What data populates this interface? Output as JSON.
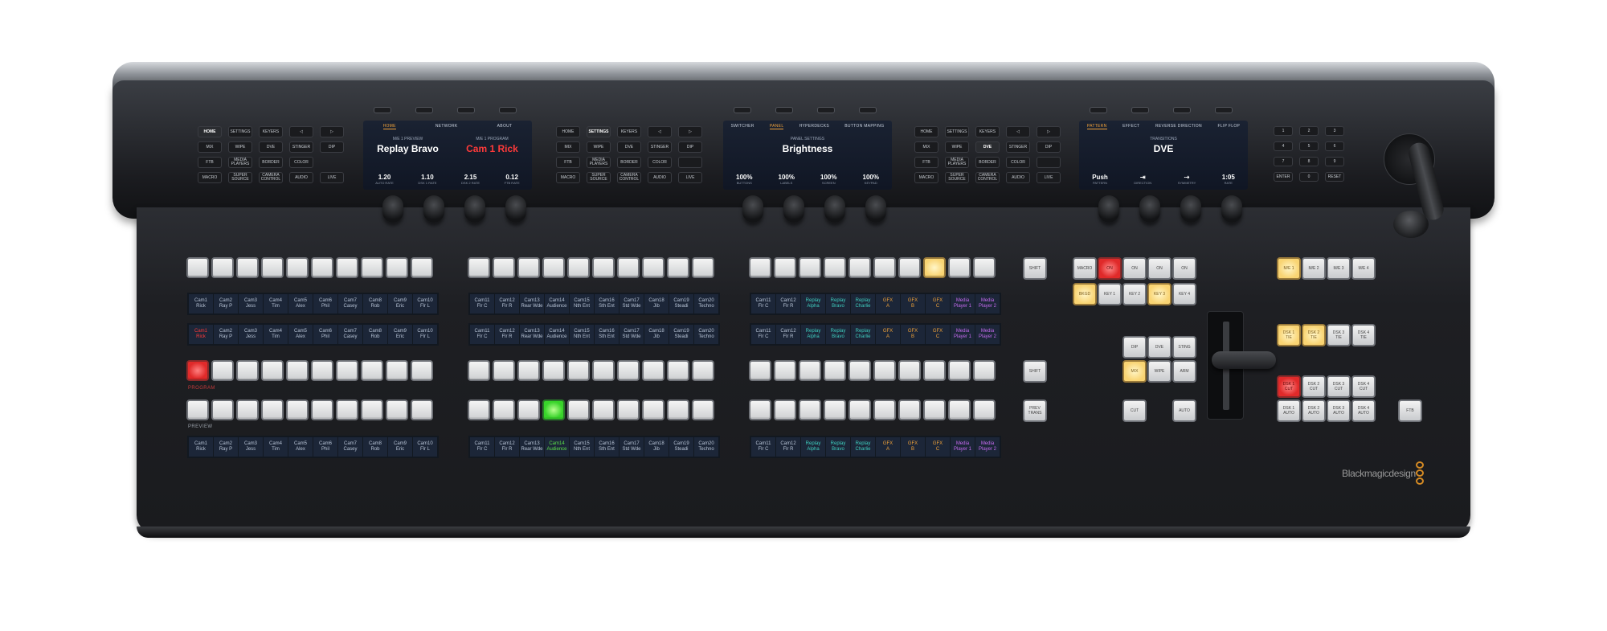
{
  "panel": {
    "brand": "Blackmagic",
    "brand_suffix": "design"
  },
  "control_grids": [
    {
      "rows": [
        [
          {
            "label": "HOME",
            "sel": true
          },
          {
            "label": "SETTINGS"
          },
          {
            "label": "KEYERS"
          },
          {
            "label": "◁"
          },
          {
            "label": "▷"
          }
        ],
        [
          {
            "label": "MIX"
          },
          {
            "label": "WIPE"
          },
          {
            "label": "DVE"
          },
          {
            "label": "STINGER"
          },
          {
            "label": "DIP"
          }
        ],
        [
          {
            "label": "FTB"
          },
          {
            "label": "MEDIA PLAYERS"
          },
          {
            "label": "BORDER"
          },
          {
            "label": "COLOR"
          }
        ],
        [
          {
            "label": "MACRO"
          },
          {
            "label": "SUPER SOURCE"
          },
          {
            "label": "CAMERA CONTROL"
          },
          {
            "label": "AUDIO"
          },
          {
            "label": "LIVE"
          }
        ]
      ]
    },
    {
      "rows": [
        [
          {
            "label": "HOME"
          },
          {
            "label": "SETTINGS",
            "sel": true
          },
          {
            "label": "KEYERS"
          },
          {
            "label": "◁"
          },
          {
            "label": "▷"
          }
        ],
        [
          {
            "label": "MIX"
          },
          {
            "label": "WIPE"
          },
          {
            "label": "DVE"
          },
          {
            "label": "STINGER"
          },
          {
            "label": "DIP"
          }
        ],
        [
          {
            "label": "FTB"
          },
          {
            "label": "MEDIA PLAYERS"
          },
          {
            "label": "BORDER"
          },
          {
            "label": "COLOR"
          },
          {
            "label": ""
          }
        ],
        [
          {
            "label": "MACRO"
          },
          {
            "label": "SUPER SOURCE"
          },
          {
            "label": "CAMERA CONTROL"
          },
          {
            "label": "AUDIO"
          },
          {
            "label": "LIVE"
          }
        ]
      ]
    },
    {
      "rows": [
        [
          {
            "label": "HOME"
          },
          {
            "label": "SETTINGS"
          },
          {
            "label": "KEYERS"
          },
          {
            "label": "◁"
          },
          {
            "label": "▷"
          }
        ],
        [
          {
            "label": "MIX"
          },
          {
            "label": "WIPE"
          },
          {
            "label": "DVE",
            "sel": true
          },
          {
            "label": "STINGER"
          },
          {
            "label": "DIP"
          }
        ],
        [
          {
            "label": "FTB"
          },
          {
            "label": "MEDIA PLAYERS"
          },
          {
            "label": "BORDER"
          },
          {
            "label": "COLOR"
          },
          {
            "label": ""
          }
        ],
        [
          {
            "label": "MACRO"
          },
          {
            "label": "SUPER SOURCE"
          },
          {
            "label": "CAMERA CONTROL"
          },
          {
            "label": "AUDIO"
          },
          {
            "label": "LIVE"
          }
        ]
      ]
    }
  ],
  "lcds": [
    {
      "tabs": [
        {
          "label": "HOME",
          "active": true
        },
        {
          "label": "NETWORK"
        },
        {
          "label": "ABOUT"
        }
      ],
      "left": {
        "sub": "M/E 1 PREVIEW",
        "big": "Replay Bravo"
      },
      "right": {
        "sub": "M/E 1 PROGRAM",
        "big": "Cam 1 Rick"
      },
      "vals": [
        {
          "v": "1.20",
          "l": "AUTO RATE"
        },
        {
          "v": "1.10",
          "l": "DSK 1 RATE"
        },
        {
          "v": "2.15",
          "l": "DSK 2 RATE"
        },
        {
          "v": "0.12",
          "l": "FTB RATE"
        }
      ]
    },
    {
      "tabs": [
        {
          "label": "SWITCHER"
        },
        {
          "label": "PANEL",
          "active": true
        },
        {
          "label": "HYPERDECKS"
        },
        {
          "label": "BUTTON MAPPING"
        }
      ],
      "sub": "PANEL SETTINGS",
      "big": "Brightness",
      "vals": [
        {
          "v": "100%",
          "l": "BUTTONS"
        },
        {
          "v": "100%",
          "l": "LABELS"
        },
        {
          "v": "100%",
          "l": "SCREEN"
        },
        {
          "v": "100%",
          "l": "KEYPAD"
        }
      ]
    },
    {
      "tabs": [
        {
          "label": "PATTERN",
          "active": true
        },
        {
          "label": "EFFECT"
        },
        {
          "label": "REVERSE DIRECTION"
        },
        {
          "label": "FLIP FLOP"
        }
      ],
      "sub": "TRANSITIONS",
      "big": "DVE",
      "vals": [
        {
          "v": "Push",
          "l": "PATTERN"
        },
        {
          "v": "⇥",
          "l": "DIRECTION"
        },
        {
          "v": "⇢",
          "l": "SYMMETRY"
        },
        {
          "v": "1:05",
          "l": "RATE"
        }
      ]
    }
  ],
  "keypad": [
    "1",
    "2",
    "3",
    "4",
    "5",
    "6",
    "7",
    "8",
    "9",
    "ENTER",
    "0",
    "RESET"
  ],
  "strip_blocks": [
    {
      "names": [
        "Cam1\nRick",
        "Cam2\nRay P",
        "Cam3\nJess",
        "Cam4\nTim",
        "Cam5\nAlex",
        "Cam6\nPhil",
        "Cam7\nCasey",
        "Cam8\nRob",
        "Cam9\nEric",
        "Cam10\nFlr L"
      ],
      "colors": [
        "",
        "",
        "",
        "",
        "",
        "",
        "",
        "",
        "",
        ""
      ]
    },
    {
      "names": [
        "Cam11\nFlr C",
        "Cam12\nFlr R",
        "Cam13\nRear Wde",
        "Cam14\nAudience",
        "Cam15\nNth Ent",
        "Cam16\nSth Ent",
        "Cam17\nStd Wde",
        "Cam18\nJib",
        "Cam19\nSteadi",
        "Cam20\nTechno"
      ],
      "colors": [
        "",
        "",
        "",
        "",
        "",
        "",
        "",
        "",
        "",
        ""
      ]
    },
    {
      "names": [
        "Cam11\nFlr C",
        "Cam12\nFlr R",
        "Replay\nAlpha",
        "Replay\nBravo",
        "Replay\nCharlie",
        "GFX\nA",
        "GFX\nB",
        "GFX\nC",
        "Media\nPlayer 1",
        "Media\nPlayer 2"
      ],
      "colors": [
        "",
        "",
        "teal",
        "teal",
        "teal",
        "orange",
        "orange",
        "orange",
        "purple",
        "purple"
      ]
    }
  ],
  "side_buttons": {
    "shift_1": "SHIFT",
    "shift_2": "SHIFT",
    "prev_trans": "PREV\nTRANS"
  },
  "row_labels": {
    "program": "PROGRAM",
    "preview": "PREVIEW"
  },
  "keyers": {
    "row1": [
      {
        "label": "MACRO"
      },
      {
        "label": "ON",
        "state": "red"
      },
      {
        "label": "ON"
      },
      {
        "label": "ON"
      },
      {
        "label": "ON"
      }
    ],
    "row2": [
      {
        "label": "BKGD",
        "state": "yellow"
      },
      {
        "label": "KEY 1"
      },
      {
        "label": "KEY 2"
      },
      {
        "label": "KEY 3",
        "state": "yellow"
      },
      {
        "label": "KEY 4"
      }
    ]
  },
  "transitions": {
    "row1": [
      "DIP",
      "DVE",
      "STING"
    ],
    "row2": [
      {
        "label": "MIX",
        "state": "yellow"
      },
      {
        "label": "WIPE"
      },
      {
        "label": "ARM"
      }
    ],
    "cut": "CUT",
    "auto": "AUTO"
  },
  "me_select": [
    {
      "label": "M/E 1",
      "state": "yellow"
    },
    {
      "label": "M/E 2"
    },
    {
      "label": "M/E 3"
    },
    {
      "label": "M/E 4"
    }
  ],
  "dsk_tie": [
    {
      "label": "DSK 1\nTIE",
      "state": "yellow"
    },
    {
      "label": "DSK 2\nTIE",
      "state": "yellow"
    },
    {
      "label": "DSK 3\nTIE"
    },
    {
      "label": "DSK 4\nTIE"
    }
  ],
  "dsk_cut": [
    {
      "label": "DSK 1\nCUT",
      "state": "red"
    },
    {
      "label": "DSK 2\nCUT"
    },
    {
      "label": "DSK 3\nCUT"
    },
    {
      "label": "DSK 4\nCUT"
    }
  ],
  "dsk_auto": [
    {
      "label": "DSK 1\nAUTO"
    },
    {
      "label": "DSK 2\nAUTO"
    },
    {
      "label": "DSK 3\nAUTO"
    },
    {
      "label": "DSK 4\nAUTO"
    }
  ],
  "ftb": "FTB",
  "bus_states": {
    "program_active_index": 0,
    "preview_active_index": 13,
    "aux_active_index": 27
  },
  "colors": {
    "program": "#e02a2a",
    "preview": "#38d42a",
    "selected": "#f9d473",
    "teal": "#3fcfc0",
    "orange": "#f0a23a",
    "purple": "#c66bf0",
    "logo_ring": "#d48a24"
  }
}
